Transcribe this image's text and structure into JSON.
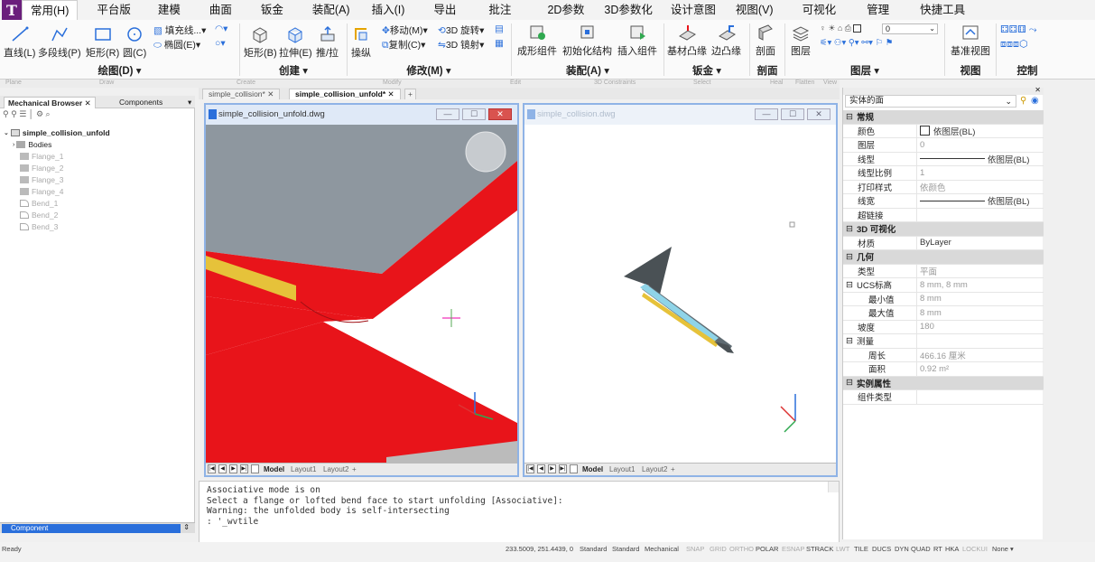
{
  "menubar": {
    "items": [
      "常用(H)",
      "平台版",
      "建模",
      "曲面",
      "钣金",
      "装配(A)",
      "插入(I)",
      "导出",
      "批注",
      "2D参数",
      "3D参数化",
      "设计意图",
      "视图(V)",
      "可视化",
      "管理",
      "快捷工具"
    ],
    "active": "常用(H)"
  },
  "ribbon": {
    "draw": {
      "title": "绘图(D) ▾",
      "line": "直线(L)",
      "polyline": "多段线(P)",
      "rect": "矩形(R)",
      "circle": "圆(C)",
      "fill": "填充线...▾",
      "ellipse": "椭圆(E)▾"
    },
    "create": {
      "title": "创建 ▾",
      "box": "矩形(B)",
      "extrude": "拉伸(E)",
      "pushpull": "推/拉"
    },
    "modify": {
      "title": "修改(M) ▾",
      "manipulate": "操纵",
      "move": "移动(M)▾",
      "copy": "复制(C)▾",
      "rotate3d": "3D 旋转▾",
      "mirror3d": "3D 镜射▾"
    },
    "assembly": {
      "title": "装配(A) ▾",
      "form": "成形组件",
      "init": "初始化结构",
      "insert": "插入组件"
    },
    "sheetmetal": {
      "title": "钣金 ▾",
      "base": "基材凸缘",
      "edge": "边凸缘"
    },
    "section": {
      "title": "剖面",
      "label": "剖面"
    },
    "layers": {
      "title": "图层 ▾",
      "label": "图层",
      "layer_value": "0"
    },
    "view": {
      "title": "视图",
      "label": "基准视图"
    },
    "control": {
      "title": "控制"
    }
  },
  "subrow": [
    "Plane",
    "Draw",
    "Create",
    "Modify",
    "Edit",
    "3D Constraints",
    "Select",
    "Heal",
    "Flatten",
    "View"
  ],
  "left_panel": {
    "tabs": [
      "Mechanical Browser",
      "Components"
    ],
    "root": "simple_collision_unfold",
    "items": [
      "Bodies",
      "Flange_1",
      "Flange_2",
      "Flange_3",
      "Flange_4",
      "Bend_1",
      "Bend_2",
      "Bend_3"
    ],
    "component_select": "Component"
  },
  "doc_tabs": [
    "simple_collision*",
    "simple_collision_unfold*"
  ],
  "viewports": {
    "left_title": "simple_collision_unfold.dwg",
    "right_title": "simple_collision.dwg",
    "layout_tabs": [
      "Model",
      "Layout1",
      "Layout2"
    ]
  },
  "command": {
    "lines": [
      "Associative mode is on",
      "Select a flange or lofted bend face to start unfolding [Associative]:",
      "Warning: the unfolded body is self-intersecting",
      ": '_wvtile"
    ]
  },
  "status": {
    "ready": "Ready",
    "coords": "233.5009, 251.4439, 0",
    "items": [
      "Standard",
      "Standard",
      "Mechanical",
      "SNAP",
      "GRID",
      "ORTHO",
      "POLAR",
      "ESNAP",
      "STRACK",
      "LWT",
      "TILE",
      "DUCS",
      "DYN",
      "QUAD",
      "RT",
      "HKA",
      "LOCKUI",
      "None ▾"
    ]
  },
  "properties": {
    "selection": "实体的面",
    "rows": [
      {
        "type": "section",
        "key": "常规"
      },
      {
        "key": "颜色",
        "value": "依图层(BL)",
        "kind": "color"
      },
      {
        "key": "图层",
        "value": "0",
        "grey": true
      },
      {
        "key": "线型",
        "value": "依图层(BL)",
        "kind": "line"
      },
      {
        "key": "线型比例",
        "value": "1",
        "grey": true
      },
      {
        "key": "打印样式",
        "value": "依颜色",
        "grey": true
      },
      {
        "key": "线宽",
        "value": "依图层(BL)",
        "kind": "line"
      },
      {
        "key": "超链接",
        "value": ""
      },
      {
        "type": "section",
        "key": "3D 可视化"
      },
      {
        "key": "材质",
        "value": "ByLayer"
      },
      {
        "type": "section",
        "key": "几何"
      },
      {
        "key": "类型",
        "value": "平面",
        "grey": true
      },
      {
        "key": "UCS标高",
        "value": "8 mm, 8 mm",
        "grey": true,
        "expand": true
      },
      {
        "key": "最小值",
        "value": "8 mm",
        "grey": true,
        "indent": true
      },
      {
        "key": "最大值",
        "value": "8 mm",
        "grey": true,
        "indent": true
      },
      {
        "key": "坡度",
        "value": "180",
        "grey": true
      },
      {
        "key": "测量",
        "value": "",
        "expand": true
      },
      {
        "key": "周长",
        "value": "466.16 厘米",
        "grey": true,
        "indent": true
      },
      {
        "key": "面积",
        "value": "0.92 m²",
        "grey": true,
        "indent": true
      },
      {
        "type": "section",
        "key": "实例属性"
      },
      {
        "key": "组件类型",
        "value": ""
      }
    ]
  },
  "colors": {
    "accent": "#6b1f7c",
    "part_red": "#e8141a",
    "part_grey": "#8e979f",
    "part_yellow": "#e6c23a",
    "viewport_border": "#8fb3e6"
  }
}
